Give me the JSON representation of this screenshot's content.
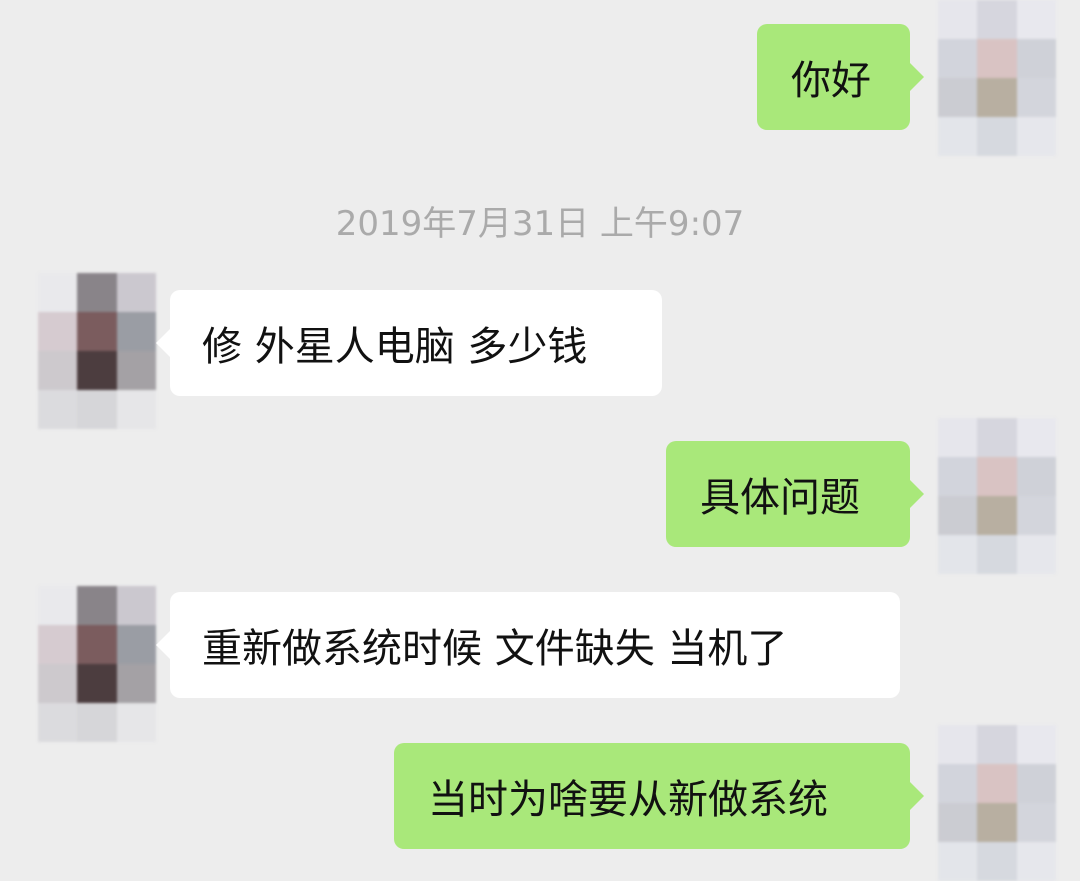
{
  "timestamp": "2019年7月31日 上午9:07",
  "messages": [
    {
      "side": "out",
      "text": "你好"
    },
    {
      "side": "in",
      "text": "修 外星人电脑 多少钱"
    },
    {
      "side": "out",
      "text": "具体问题"
    },
    {
      "side": "in",
      "text": "重新做系统时候 文件缺失 当机了"
    },
    {
      "side": "out",
      "text": "当时为啥要从新做系统"
    }
  ],
  "avatars": {
    "self": {
      "icon": "blurred-user-avatar-icon",
      "colors": [
        "#e6e6ec",
        "#d6d6de",
        "#e8e8ee",
        "#d2d4dc",
        "#d9c3c3",
        "#cfd1d8",
        "#cbccd2",
        "#b8afa1",
        "#d3d5dc",
        "#e3e5ea",
        "#d6d9df",
        "#e6e7ec"
      ]
    },
    "contact": {
      "icon": "blurred-contact-avatar-icon",
      "colors": [
        "#e9e9ec",
        "#898489",
        "#cbc8cf",
        "#d6cbd0",
        "#7b5c5e",
        "#9a9da4",
        "#cdc9cd",
        "#4c3d3f",
        "#a4a1a5",
        "#dbdbde",
        "#d6d6d9",
        "#e6e6e8"
      ]
    }
  }
}
